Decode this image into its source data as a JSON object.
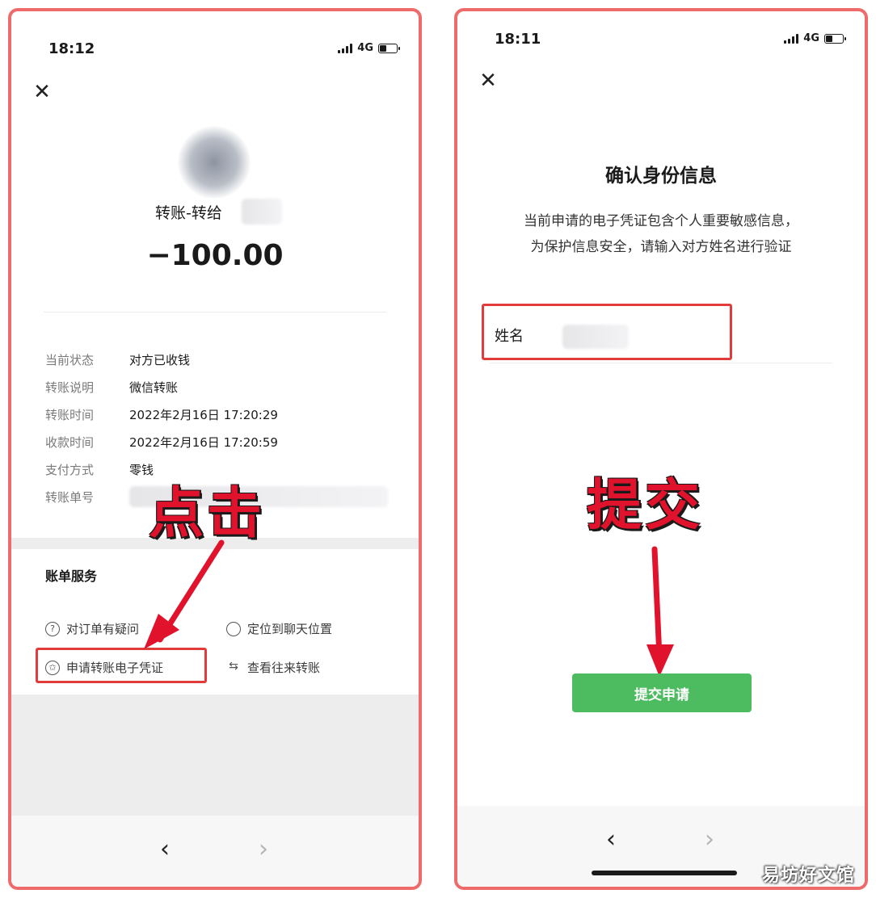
{
  "left": {
    "status": {
      "time": "18:12",
      "network": "4G"
    },
    "transfer_title": "转账-转给",
    "amount": "−100.00",
    "details": [
      {
        "label": "当前状态",
        "value": "对方已收钱"
      },
      {
        "label": "转账说明",
        "value": "微信转账"
      },
      {
        "label": "转账时间",
        "value": "2022年2月16日 17:20:29"
      },
      {
        "label": "收款时间",
        "value": "2022年2月16日 17:20:59"
      },
      {
        "label": "支付方式",
        "value": "零钱"
      },
      {
        "label": "转账单号",
        "value": ""
      }
    ],
    "services_title": "账单服务",
    "services": {
      "question": "对订单有疑问",
      "locate": "定位到聊天位置",
      "voucher": "申请转账电子凭证",
      "history": "查看往来转账"
    },
    "annotation": "点击"
  },
  "right": {
    "status": {
      "time": "18:11",
      "network": "4G"
    },
    "title": "确认身份信息",
    "desc_line1": "当前申请的电子凭证包含个人重要敏感信息，",
    "desc_line2": "为保护信息安全，请输入对方姓名进行验证",
    "name_label": "姓名",
    "submit": "提交申请",
    "annotation": "提交"
  },
  "nav": {
    "back": "‹",
    "forward": "›"
  },
  "watermark": "易坊好文馆",
  "colors": {
    "frame": "#ef6b6b",
    "highlight": "#e23b3b",
    "annotation": "#e0122c",
    "button": "#4dbb5f"
  }
}
